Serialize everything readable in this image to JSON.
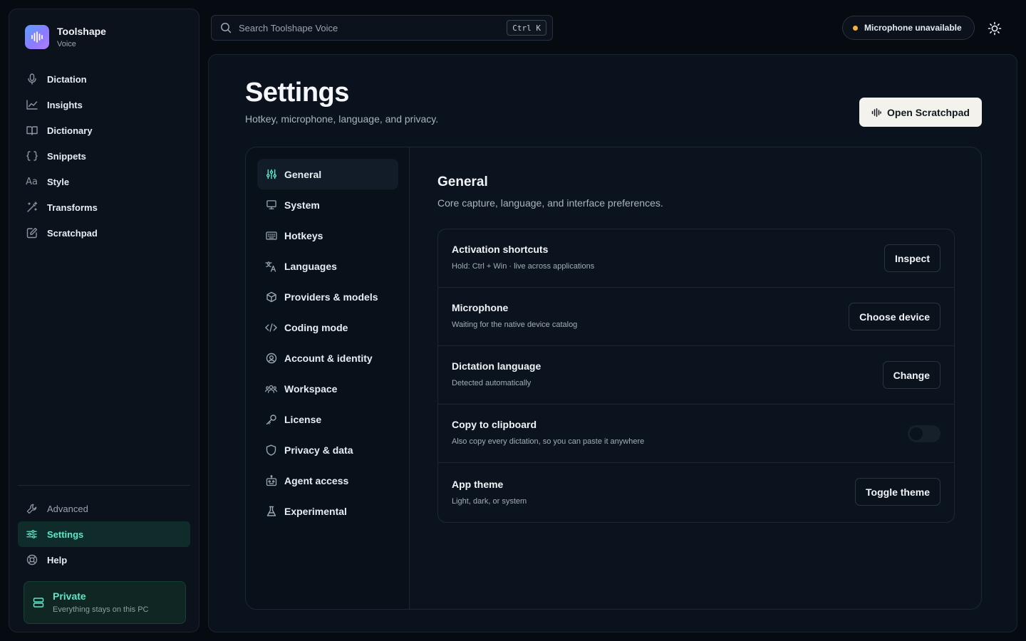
{
  "brand": {
    "title": "Toolshape",
    "subtitle": "Voice"
  },
  "sidebar": {
    "items": [
      {
        "label": "Dictation",
        "icon": "microphone-icon"
      },
      {
        "label": "Insights",
        "icon": "chart-line-icon"
      },
      {
        "label": "Dictionary",
        "icon": "book-icon"
      },
      {
        "label": "Snippets",
        "icon": "braces-icon"
      },
      {
        "label": "Style",
        "icon": "text-style-icon"
      },
      {
        "label": "Transforms",
        "icon": "magic-wand-icon"
      },
      {
        "label": "Scratchpad",
        "icon": "edit-icon"
      }
    ],
    "bottom": [
      {
        "label": "Advanced",
        "icon": "wrench-icon"
      },
      {
        "label": "Settings",
        "icon": "sliders-icon",
        "active": true
      },
      {
        "label": "Help",
        "icon": "lifebuoy-icon"
      }
    ],
    "private_card": {
      "title": "Private",
      "subtitle": "Everything stays on this PC"
    }
  },
  "topbar": {
    "search_placeholder": "Search Toolshape Voice",
    "search_shortcut": "Ctrl K",
    "mic_status": "Microphone unavailable",
    "mic_status_color": "#f2b441"
  },
  "page": {
    "title": "Settings",
    "subtitle": "Hotkey, microphone, language, and privacy.",
    "open_scratchpad": "Open Scratchpad"
  },
  "settings_nav": [
    {
      "label": "General",
      "icon": "sliders-icon",
      "active": true
    },
    {
      "label": "System",
      "icon": "monitor-icon"
    },
    {
      "label": "Hotkeys",
      "icon": "keyboard-icon"
    },
    {
      "label": "Languages",
      "icon": "translate-icon"
    },
    {
      "label": "Providers & models",
      "icon": "cube-icon"
    },
    {
      "label": "Coding mode",
      "icon": "code-icon"
    },
    {
      "label": "Account & identity",
      "icon": "user-circle-icon"
    },
    {
      "label": "Workspace",
      "icon": "users-icon"
    },
    {
      "label": "License",
      "icon": "key-icon"
    },
    {
      "label": "Privacy & data",
      "icon": "shield-icon"
    },
    {
      "label": "Agent access",
      "icon": "robot-icon"
    },
    {
      "label": "Experimental",
      "icon": "flask-icon"
    }
  ],
  "general": {
    "title": "General",
    "subtitle": "Core capture, language, and interface preferences.",
    "rows": [
      {
        "title": "Activation shortcuts",
        "subtitle": "Hold: Ctrl + Win · live across applications",
        "action": "Inspect"
      },
      {
        "title": "Microphone",
        "subtitle": "Waiting for the native device catalog",
        "action": "Choose device"
      },
      {
        "title": "Dictation language",
        "subtitle": "Detected automatically",
        "action": "Change"
      },
      {
        "title": "Copy to clipboard",
        "subtitle": "Also copy every dictation, so you can paste it anywhere",
        "toggle": false
      },
      {
        "title": "App theme",
        "subtitle": "Light, dark, or system",
        "action": "Toggle theme"
      }
    ]
  },
  "colors": {
    "accent": "#5ee6c8",
    "background": "#060b12",
    "panel": "#0a131d"
  }
}
